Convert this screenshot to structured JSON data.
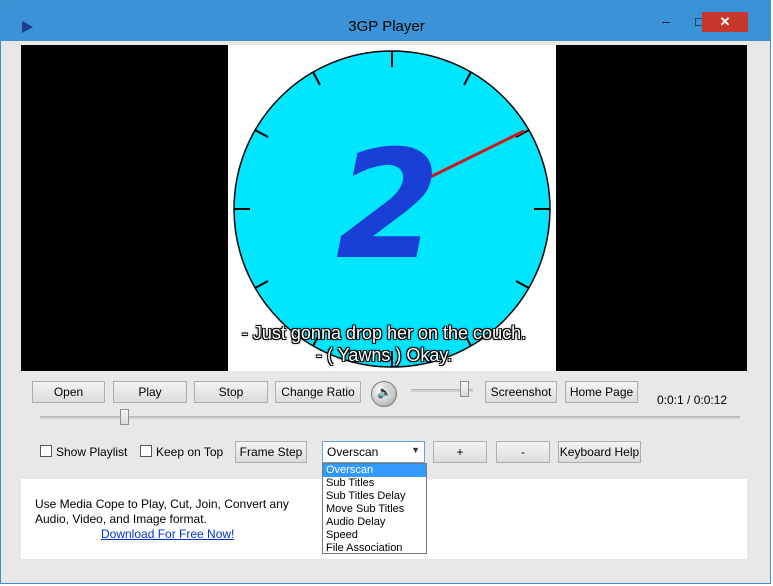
{
  "window": {
    "title": "3GP Player"
  },
  "titlebar_buttons": {
    "minimize": "–",
    "maximize": "□",
    "close": "✕"
  },
  "video": {
    "subtitle_line1": "- Just gonna drop her on the couch.",
    "subtitle_line2": "- ( Yawns ) Okay.",
    "countdown_number": "2",
    "colors": {
      "dial": "#00e6ff",
      "number": "#1a3fd6",
      "hand": "#cc1a1a",
      "letterbox": "#000000"
    }
  },
  "controls": {
    "open_label": "Open",
    "play_label": "Play",
    "stop_label": "Stop",
    "change_ratio_label": "Change Ratio",
    "volume_icon": "speaker-icon",
    "screenshot_label": "Screenshot",
    "home_page_label": "Home Page",
    "time_display": "0:0:1 / 0:0:12",
    "seek_position": 0.12,
    "volume_level": 0.85
  },
  "options": {
    "show_playlist_label": "Show Playlist",
    "show_playlist_checked": false,
    "keep_on_top_label": "Keep on Top",
    "keep_on_top_checked": false,
    "frame_step_label": "Frame Step",
    "mode_select_value": "Overscan",
    "plus_label": "+",
    "minus_label": "-",
    "keyboard_help_label": "Keyboard Help"
  },
  "dropdown": {
    "items": [
      "Overscan",
      "Sub Titles",
      "Sub Titles Delay",
      "Move Sub Titles",
      "Audio Delay",
      "Speed",
      "File Association"
    ],
    "selected_index": 0
  },
  "promo": {
    "line1": "Use Media Cope to Play, Cut, Join, Convert any",
    "line2": "Audio, Video, and Image format.",
    "link": "Download For Free Now!"
  }
}
